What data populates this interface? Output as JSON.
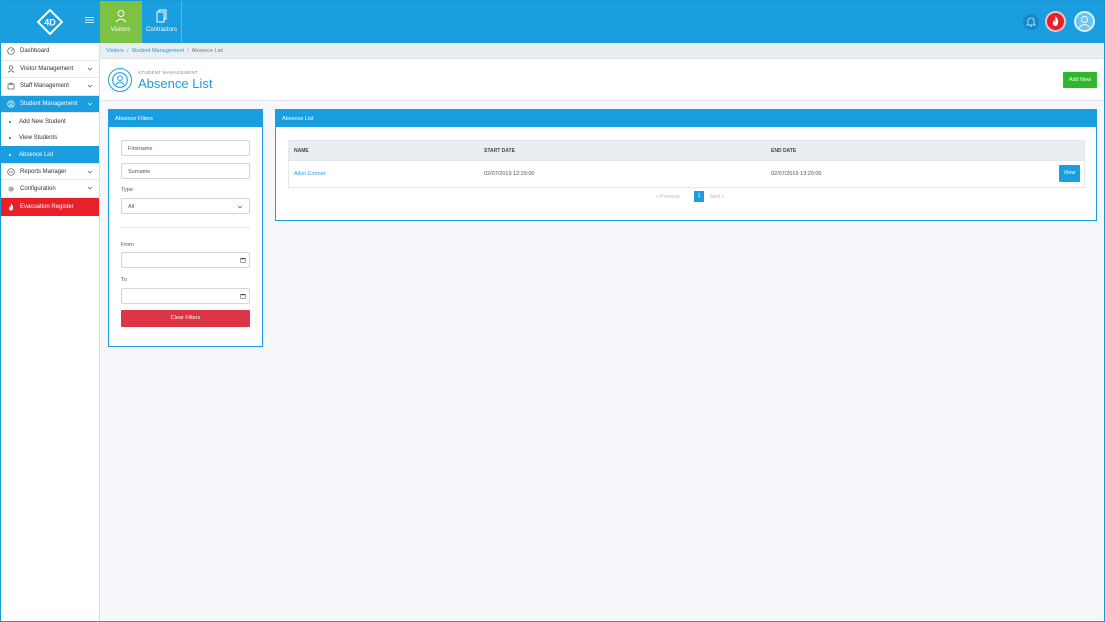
{
  "topbar": {
    "logo_text": "4D",
    "tabs": [
      {
        "label": "Visitors",
        "icon": "user-icon",
        "active": true
      },
      {
        "label": "Contractors",
        "icon": "documents-icon",
        "active": false
      }
    ],
    "right_icons": [
      "bell-icon",
      "fire-icon",
      "avatar-icon"
    ]
  },
  "sidebar": {
    "items": [
      {
        "label": "Dashboard",
        "icon": "dashboard-icon",
        "expandable": false
      },
      {
        "label": "Visitor Management",
        "icon": "user-icon",
        "expandable": true
      },
      {
        "label": "Staff Management",
        "icon": "staff-icon",
        "expandable": true
      },
      {
        "label": "Student Management",
        "icon": "student-icon",
        "expandable": true,
        "active": true
      },
      {
        "label": "Add New Student",
        "sub": true
      },
      {
        "label": "View Students",
        "sub": true
      },
      {
        "label": "Absence List",
        "sub": true,
        "active": true
      },
      {
        "label": "Reports Manager",
        "icon": "reports-icon",
        "expandable": true
      },
      {
        "label": "Configuration",
        "icon": "gear-icon",
        "expandable": true
      },
      {
        "label": "Evacuation Register",
        "icon": "fire-icon",
        "evac": true
      }
    ]
  },
  "breadcrumb": {
    "items": [
      "Visitors",
      "Student Management",
      "Absence List"
    ],
    "separator": "/"
  },
  "header": {
    "subtitle": "STUDENT MANAGEMENT",
    "title": "Absence List",
    "add_new": "Add New"
  },
  "filters": {
    "title": "Absence Filters",
    "firstname_placeholder": "Firstname",
    "surname_placeholder": "Surname",
    "type_label": "Type",
    "type_value": "All",
    "from_label": "From",
    "to_label": "To",
    "clear_label": "Clear Filters"
  },
  "list": {
    "title": "Absence List",
    "columns": [
      "NAME",
      "START DATE",
      "END DATE"
    ],
    "rows": [
      {
        "name": "Ailso Conner",
        "start": "02/07/2019 12:29:00",
        "end": "02/07/2019 13:29:00",
        "action": "View"
      }
    ],
    "pager": {
      "previous": "« Previous",
      "page": "1",
      "next": "Next »"
    }
  },
  "colors": {
    "primary": "#1a9ee0",
    "active_tab": "#7dc243",
    "add": "#2eb82e",
    "danger": "#dc3545",
    "evac": "#e8202a"
  }
}
